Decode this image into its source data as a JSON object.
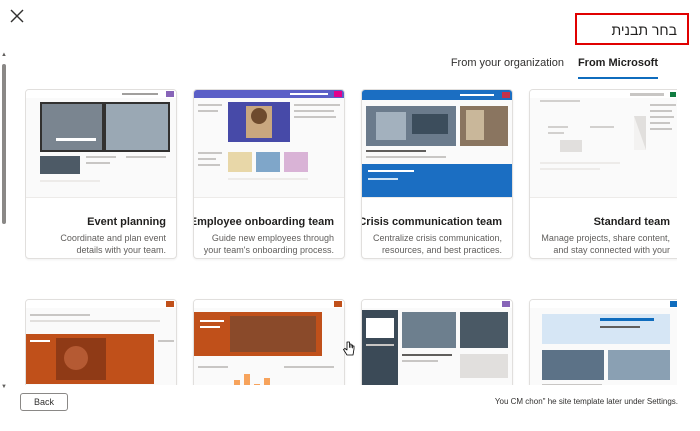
{
  "dialog": {
    "title": "בחר תבנית",
    "close_icon": "close-icon"
  },
  "tabs": [
    {
      "label": "From Microsoft",
      "active": true
    },
    {
      "label": "From your organization",
      "active": false
    }
  ],
  "templates": [
    {
      "title": "Standard team",
      "description": "Manage projects, share content, and stay connected with your team."
    },
    {
      "title": "Crisis communication team",
      "description": "Centralize crisis communication, resources, and best practices."
    },
    {
      "title": "Employee onboarding team",
      "description": "Guide new employees through your team's onboarding process."
    },
    {
      "title": "Event planning",
      "description": "Coordinate and plan event details with your team."
    },
    {
      "title": "",
      "description": ""
    },
    {
      "title": "",
      "description": ""
    },
    {
      "title": "",
      "description": ""
    },
    {
      "title": "",
      "description": ""
    }
  ],
  "footer": {
    "back_label": "Back",
    "note": "You CM chon\" he site template later under Settings."
  },
  "colors": {
    "accent": "#0f6cbd",
    "highlight_border": "#e00000",
    "crisis_blue": "#1b6ec2",
    "onboarding_purple": "#5b5fc7",
    "event_dark": "#323130",
    "orange": "#c0501a"
  }
}
